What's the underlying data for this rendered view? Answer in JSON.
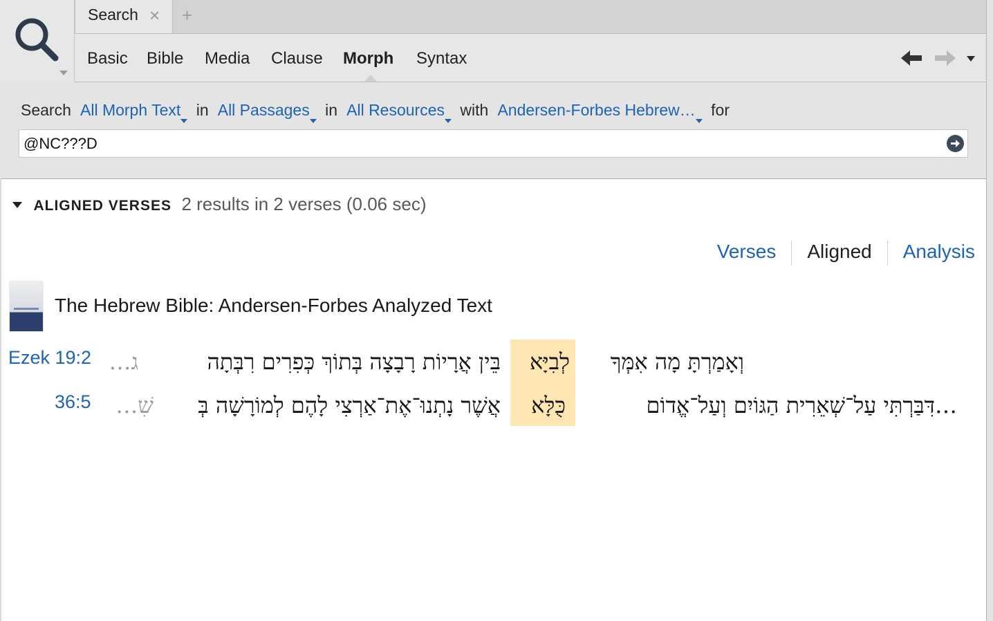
{
  "tab": {
    "label": "Search",
    "close": "×",
    "new": "+"
  },
  "modes": [
    "Basic",
    "Bible",
    "Media",
    "Clause",
    "Morph",
    "Syntax"
  ],
  "active_mode": "Morph",
  "criteria": {
    "search_label": "Search",
    "scope_text": "All Morph Text",
    "in1": "in",
    "passages": "All Passages",
    "in2": "in",
    "resources": "All Resources",
    "with": "with",
    "morph": "Andersen-Forbes Hebrew…",
    "for": "for"
  },
  "query": {
    "value": "@NC???D"
  },
  "results": {
    "section_title": "ALIGNED VERSES",
    "summary": "2 results in 2 verses (0.06 sec)"
  },
  "view_tabs": [
    "Verses",
    "Aligned",
    "Analysis"
  ],
  "active_view": "Aligned",
  "resource_title": "The Hebrew Bible: Andersen-Forbes Analyzed Text",
  "verses": [
    {
      "ref": "Ezek 19:2",
      "before": "וְאָמַרְתָּ מָה אִמְּךָ",
      "hit": "לְבִיָּא",
      "after": "בֵּין אֲרָיוֹת רָבָצָה בְּתוֹךְ כְּפִרִים רִבְּתָה",
      "fade": "ג…"
    },
    {
      "ref": "36:5",
      "before": "…דִּבַּרְתִּי עַל־שְׁאֵרִית הַגּוֹיִם וְעַל־אֱדוֹם",
      "hit": "כֻּלָּא",
      "after": "אֲשֶׁר נָתְנוּ־אֶת־אַרְצִי לָהֶם לְמוֹרָשָׁה בְּ",
      "fade": "שִׁ…"
    }
  ],
  "colors": {
    "link": "#1d63b4",
    "highlight": "#fde6b2",
    "chrome": "#e4e4e4"
  },
  "icons": [
    "search-icon",
    "close-icon",
    "add-tab-icon",
    "back-arrow-icon",
    "forward-arrow-icon",
    "menu-chevron-icon",
    "go-arrow-icon",
    "disclosure-triangle-icon",
    "book-cover-icon"
  ]
}
